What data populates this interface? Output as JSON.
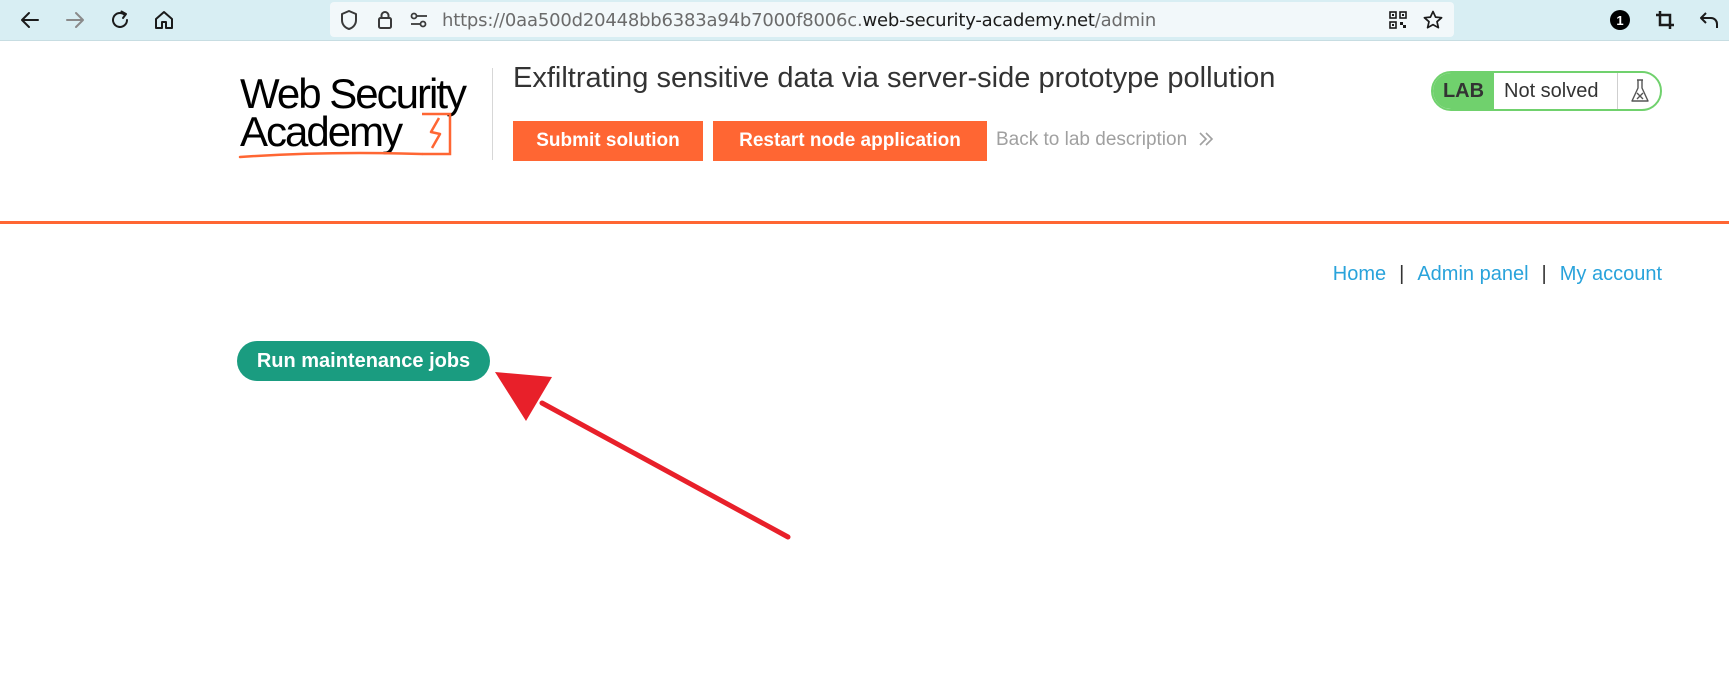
{
  "browser": {
    "url_prefix": "https://0aa500d20448bb6383a94b7000f8006c.",
    "url_host": "web-security-academy.net",
    "url_path": "/admin",
    "icons": [
      "back-icon",
      "forward-icon",
      "reload-icon",
      "home-icon",
      "shield-icon",
      "lock-icon",
      "permissions-icon",
      "qr-code-icon",
      "star-icon",
      "extension-badge-icon",
      "crop-icon",
      "undo-icon"
    ],
    "extension_badge": "1"
  },
  "lab_header": {
    "logo_line1": "Web Security",
    "logo_line2": "Academy",
    "title": "Exfiltrating sensitive data via server-side prototype pollution",
    "submit_label": "Submit solution",
    "restart_label": "Restart node application",
    "back_label": "Back to lab description",
    "status_tag": "LAB",
    "status_text": "Not solved"
  },
  "nav": {
    "home": "Home",
    "admin": "Admin panel",
    "account": "My account",
    "separator": "|"
  },
  "main": {
    "run_button": "Run maintenance jobs"
  },
  "colors": {
    "accent_orange": "#ff6633",
    "accent_green": "#1a9c80",
    "lab_green": "#70d16d",
    "link_blue": "#29a3db",
    "annotation_red": "#e8202a"
  }
}
